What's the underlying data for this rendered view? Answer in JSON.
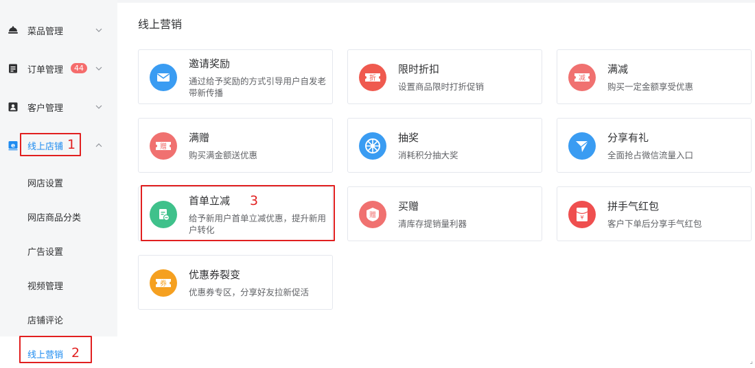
{
  "sidebar": {
    "items": [
      {
        "label": "菜品管理"
      },
      {
        "label": "订单管理",
        "badge": "44"
      },
      {
        "label": "客户管理"
      },
      {
        "label": "线上店铺"
      }
    ],
    "subitems": [
      {
        "label": "网店设置"
      },
      {
        "label": "网店商品分类"
      },
      {
        "label": "广告设置"
      },
      {
        "label": "视频管理"
      },
      {
        "label": "店铺评论"
      },
      {
        "label": "线上营销"
      }
    ]
  },
  "annotations": [
    "1",
    "2",
    "3"
  ],
  "main": {
    "title": "线上营销",
    "cards": [
      {
        "title": "邀请奖励",
        "desc": "通过给予奖励的方式引导用户自发老带新传播",
        "icon": "envelope-icon",
        "color": "#3a9cf2"
      },
      {
        "title": "限时折扣",
        "desc": "设置商品限时打折促销",
        "icon": "discount-ticket-icon",
        "color": "#ef5a4f",
        "glyph": "折"
      },
      {
        "title": "满减",
        "desc": "购买一定金额享受优惠",
        "icon": "reduction-ticket-icon",
        "color": "#f07170",
        "glyph": "减"
      },
      {
        "title": "满赠",
        "desc": "购买满金额送优惠",
        "icon": "gift-ticket-icon",
        "color": "#f07170",
        "glyph": "赠"
      },
      {
        "title": "抽奖",
        "desc": "消耗积分抽大奖",
        "icon": "lottery-wheel-icon",
        "color": "#3a9cf2"
      },
      {
        "title": "分享有礼",
        "desc": "全面抢占微信流量入口",
        "icon": "share-plane-icon",
        "color": "#3a9cf2"
      },
      {
        "title": "首单立减",
        "desc": "给予新用户首单立减优惠，提升新用户转化",
        "icon": "first-order-icon",
        "color": "#3fc18b"
      },
      {
        "title": "买赠",
        "desc": "清库存提销量利器",
        "icon": "buy-gift-badge-icon",
        "color": "#f07170",
        "glyph": "赠"
      },
      {
        "title": "拼手气红包",
        "desc": "客户下单后分享手气红包",
        "icon": "red-packet-icon",
        "color": "#ef4f4f",
        "glyph": "¥"
      },
      {
        "title": "优惠券裂变",
        "desc": "优惠券专区，分享好友拉新促活",
        "icon": "coupon-icon",
        "color": "#f5a020",
        "glyph": "券"
      }
    ]
  }
}
